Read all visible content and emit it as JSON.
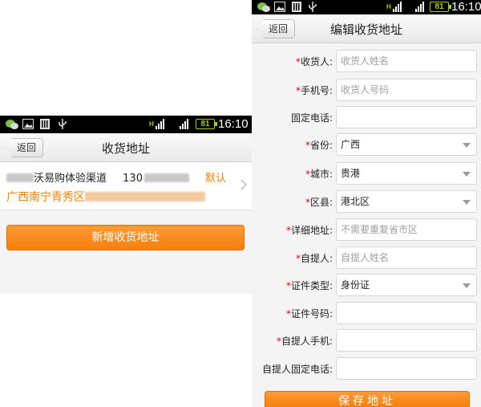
{
  "status": {
    "left_time": "16:10",
    "right_time": "16:10",
    "battery": "81",
    "h_text": "H"
  },
  "list_screen": {
    "back_label": "返回",
    "title": "收货地址",
    "address": {
      "name_visible": "沃易购体验渠道",
      "phone_visible": "130",
      "default_label": "默认",
      "region_visible": "广西南宁青秀区"
    },
    "add_button": "新增收货地址"
  },
  "edit_screen": {
    "back_label": "返回",
    "title": "编辑收货地址",
    "fields": [
      {
        "label": "收货人:",
        "required": "*",
        "value": "",
        "placeholder": "收货人姓名",
        "type": "input"
      },
      {
        "label": "手机号:",
        "required": "*",
        "value": "",
        "placeholder": "收货人号码",
        "type": "input"
      },
      {
        "label": "固定电话:",
        "required": "",
        "value": "",
        "placeholder": "",
        "type": "input"
      },
      {
        "label": "省份:",
        "required": "*",
        "value": "广西",
        "placeholder": "",
        "type": "select"
      },
      {
        "label": "城市:",
        "required": "*",
        "value": "贵港",
        "placeholder": "",
        "type": "select"
      },
      {
        "label": "区县:",
        "required": "*",
        "value": "港北区",
        "placeholder": "",
        "type": "select"
      },
      {
        "label": "详细地址:",
        "required": "*",
        "value": "",
        "placeholder": "不需要重复省市区",
        "type": "input"
      },
      {
        "label": "自提人:",
        "required": "*",
        "value": "",
        "placeholder": "自提人姓名",
        "type": "input"
      },
      {
        "label": "证件类型:",
        "required": "*",
        "value": "身份证",
        "placeholder": "",
        "type": "select"
      },
      {
        "label": "证件号码:",
        "required": "*",
        "value": "",
        "placeholder": "",
        "type": "input"
      },
      {
        "label": "自提人手机:",
        "required": "*",
        "value": "",
        "placeholder": "",
        "type": "input"
      },
      {
        "label": "自提人固定电话:",
        "required": "",
        "value": "",
        "placeholder": "",
        "type": "input"
      }
    ],
    "save_button": "保存地址"
  },
  "colors": {
    "accent": "#f57f0d",
    "required": "#e60012",
    "battery": "#9fd400"
  }
}
